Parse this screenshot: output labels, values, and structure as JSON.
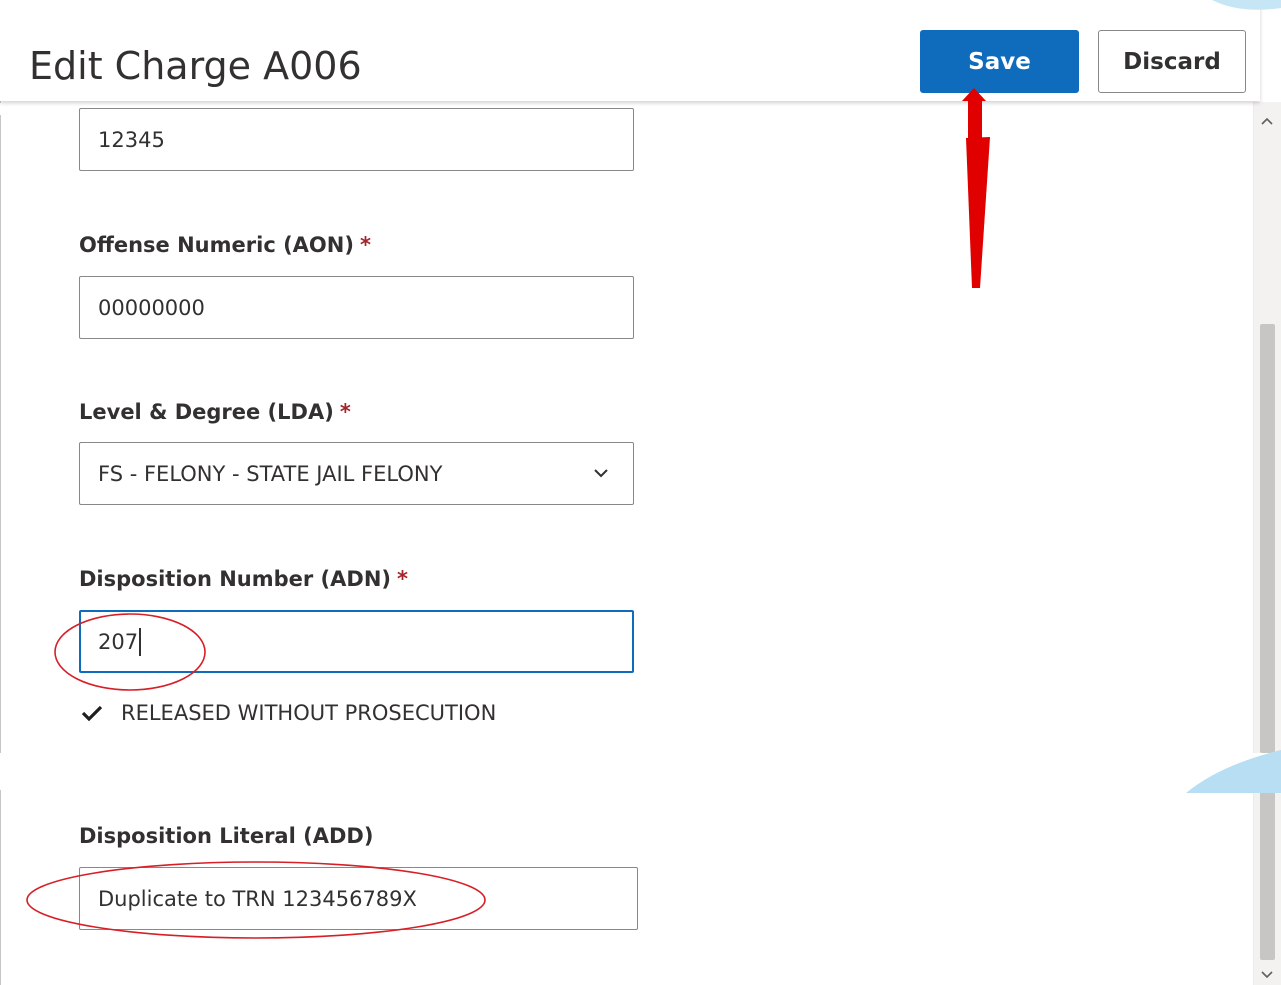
{
  "header": {
    "title": "Edit Charge A006",
    "save_label": "Save",
    "discard_label": "Discard"
  },
  "form": {
    "top_field_value": "12345",
    "offense_numeric": {
      "label": "Offense Numeric (AON)",
      "required_mark": "*",
      "value": "00000000"
    },
    "level_degree": {
      "label": "Level & Degree (LDA)",
      "required_mark": "*",
      "selected": "FS - FELONY - STATE JAIL FELONY"
    },
    "disposition_number": {
      "label": "Disposition Number (ADN)",
      "required_mark": "*",
      "value": "207"
    },
    "disposition_hint": "RELEASED WITHOUT PROSECUTION",
    "disposition_literal": {
      "label": "Disposition Literal (ADD)",
      "value": "Duplicate to TRN 123456789X"
    }
  },
  "colors": {
    "primary": "#0f6cbd",
    "required": "#a4262c",
    "annotation_red": "#e00000"
  },
  "icons": [
    "chevron-down-icon",
    "checkmark-icon",
    "scroll-up-icon",
    "scroll-down-icon"
  ]
}
